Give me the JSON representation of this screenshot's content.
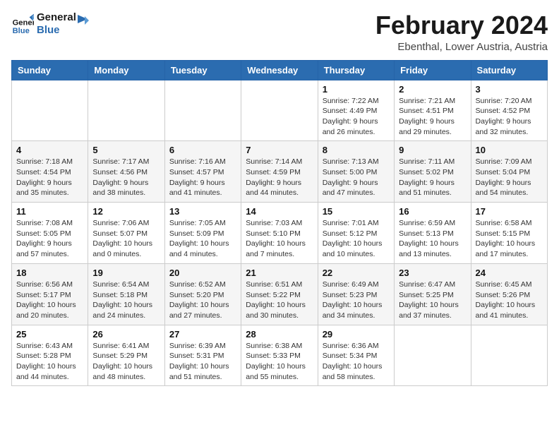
{
  "logo": {
    "line1": "General",
    "line2": "Blue"
  },
  "title": "February 2024",
  "location": "Ebenthal, Lower Austria, Austria",
  "days_of_week": [
    "Sunday",
    "Monday",
    "Tuesday",
    "Wednesday",
    "Thursday",
    "Friday",
    "Saturday"
  ],
  "weeks": [
    [
      {
        "day": "",
        "info": ""
      },
      {
        "day": "",
        "info": ""
      },
      {
        "day": "",
        "info": ""
      },
      {
        "day": "",
        "info": ""
      },
      {
        "day": "1",
        "info": "Sunrise: 7:22 AM\nSunset: 4:49 PM\nDaylight: 9 hours\nand 26 minutes."
      },
      {
        "day": "2",
        "info": "Sunrise: 7:21 AM\nSunset: 4:51 PM\nDaylight: 9 hours\nand 29 minutes."
      },
      {
        "day": "3",
        "info": "Sunrise: 7:20 AM\nSunset: 4:52 PM\nDaylight: 9 hours\nand 32 minutes."
      }
    ],
    [
      {
        "day": "4",
        "info": "Sunrise: 7:18 AM\nSunset: 4:54 PM\nDaylight: 9 hours\nand 35 minutes."
      },
      {
        "day": "5",
        "info": "Sunrise: 7:17 AM\nSunset: 4:56 PM\nDaylight: 9 hours\nand 38 minutes."
      },
      {
        "day": "6",
        "info": "Sunrise: 7:16 AM\nSunset: 4:57 PM\nDaylight: 9 hours\nand 41 minutes."
      },
      {
        "day": "7",
        "info": "Sunrise: 7:14 AM\nSunset: 4:59 PM\nDaylight: 9 hours\nand 44 minutes."
      },
      {
        "day": "8",
        "info": "Sunrise: 7:13 AM\nSunset: 5:00 PM\nDaylight: 9 hours\nand 47 minutes."
      },
      {
        "day": "9",
        "info": "Sunrise: 7:11 AM\nSunset: 5:02 PM\nDaylight: 9 hours\nand 51 minutes."
      },
      {
        "day": "10",
        "info": "Sunrise: 7:09 AM\nSunset: 5:04 PM\nDaylight: 9 hours\nand 54 minutes."
      }
    ],
    [
      {
        "day": "11",
        "info": "Sunrise: 7:08 AM\nSunset: 5:05 PM\nDaylight: 9 hours\nand 57 minutes."
      },
      {
        "day": "12",
        "info": "Sunrise: 7:06 AM\nSunset: 5:07 PM\nDaylight: 10 hours\nand 0 minutes."
      },
      {
        "day": "13",
        "info": "Sunrise: 7:05 AM\nSunset: 5:09 PM\nDaylight: 10 hours\nand 4 minutes."
      },
      {
        "day": "14",
        "info": "Sunrise: 7:03 AM\nSunset: 5:10 PM\nDaylight: 10 hours\nand 7 minutes."
      },
      {
        "day": "15",
        "info": "Sunrise: 7:01 AM\nSunset: 5:12 PM\nDaylight: 10 hours\nand 10 minutes."
      },
      {
        "day": "16",
        "info": "Sunrise: 6:59 AM\nSunset: 5:13 PM\nDaylight: 10 hours\nand 13 minutes."
      },
      {
        "day": "17",
        "info": "Sunrise: 6:58 AM\nSunset: 5:15 PM\nDaylight: 10 hours\nand 17 minutes."
      }
    ],
    [
      {
        "day": "18",
        "info": "Sunrise: 6:56 AM\nSunset: 5:17 PM\nDaylight: 10 hours\nand 20 minutes."
      },
      {
        "day": "19",
        "info": "Sunrise: 6:54 AM\nSunset: 5:18 PM\nDaylight: 10 hours\nand 24 minutes."
      },
      {
        "day": "20",
        "info": "Sunrise: 6:52 AM\nSunset: 5:20 PM\nDaylight: 10 hours\nand 27 minutes."
      },
      {
        "day": "21",
        "info": "Sunrise: 6:51 AM\nSunset: 5:22 PM\nDaylight: 10 hours\nand 30 minutes."
      },
      {
        "day": "22",
        "info": "Sunrise: 6:49 AM\nSunset: 5:23 PM\nDaylight: 10 hours\nand 34 minutes."
      },
      {
        "day": "23",
        "info": "Sunrise: 6:47 AM\nSunset: 5:25 PM\nDaylight: 10 hours\nand 37 minutes."
      },
      {
        "day": "24",
        "info": "Sunrise: 6:45 AM\nSunset: 5:26 PM\nDaylight: 10 hours\nand 41 minutes."
      }
    ],
    [
      {
        "day": "25",
        "info": "Sunrise: 6:43 AM\nSunset: 5:28 PM\nDaylight: 10 hours\nand 44 minutes."
      },
      {
        "day": "26",
        "info": "Sunrise: 6:41 AM\nSunset: 5:29 PM\nDaylight: 10 hours\nand 48 minutes."
      },
      {
        "day": "27",
        "info": "Sunrise: 6:39 AM\nSunset: 5:31 PM\nDaylight: 10 hours\nand 51 minutes."
      },
      {
        "day": "28",
        "info": "Sunrise: 6:38 AM\nSunset: 5:33 PM\nDaylight: 10 hours\nand 55 minutes."
      },
      {
        "day": "29",
        "info": "Sunrise: 6:36 AM\nSunset: 5:34 PM\nDaylight: 10 hours\nand 58 minutes."
      },
      {
        "day": "",
        "info": ""
      },
      {
        "day": "",
        "info": ""
      }
    ]
  ]
}
